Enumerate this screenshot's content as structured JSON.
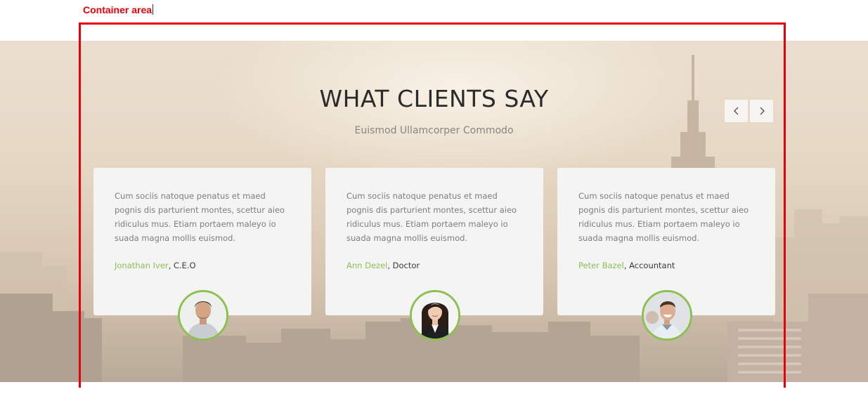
{
  "annotation": {
    "label": "Container area",
    "color": "#e8000b"
  },
  "section": {
    "title": "WHAT CLIENTS SAY",
    "subtitle": "Euismod Ullamcorper Commodo"
  },
  "carousel": {
    "prev_icon": "chevron-left-icon",
    "next_icon": "chevron-right-icon"
  },
  "accent_color": "#8cc152",
  "testimonials": [
    {
      "text": "Cum sociis natoque penatus et maed pognis dis parturient montes, scettur aieo ridiculus mus. Etiam portaem maleyo io suada magna mollis euismod.",
      "name": "Jonathan Iver",
      "role": ", C.E.O"
    },
    {
      "text": "Cum sociis natoque penatus et maed pognis dis parturient montes, scettur aieo ridiculus mus. Etiam portaem maleyo io suada magna mollis euismod.",
      "name": "Ann Dezel",
      "role": ", Doctor"
    },
    {
      "text": "Cum sociis natoque penatus et maed pognis dis parturient montes, scettur aieo ridiculus mus. Etiam portaem maleyo io suada magna mollis euismod.",
      "name": "Peter Bazel",
      "role": ", Accountant"
    }
  ]
}
